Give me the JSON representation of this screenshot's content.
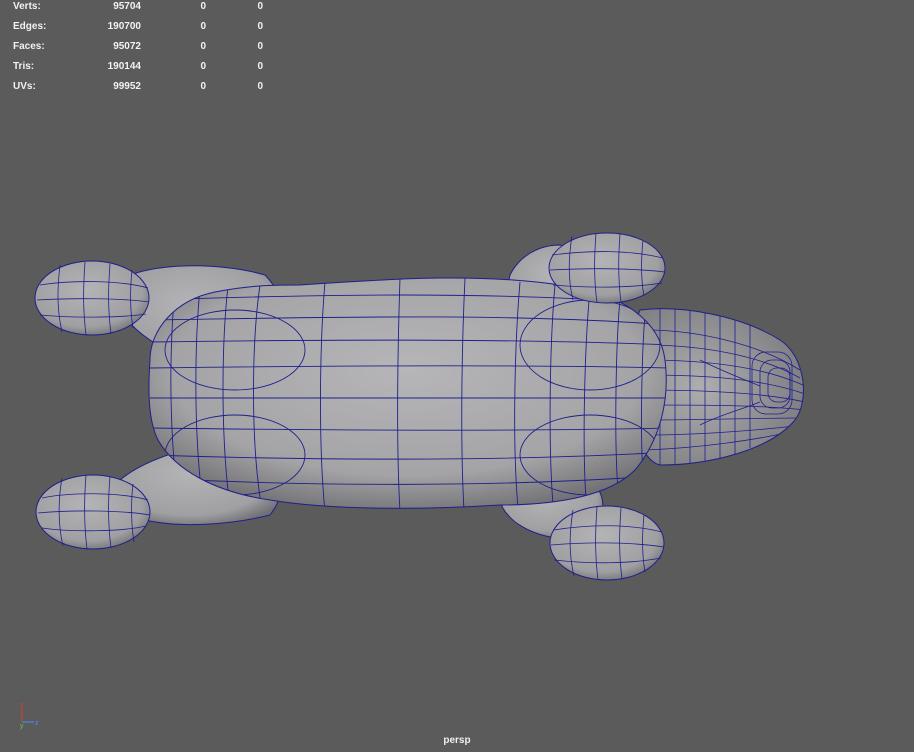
{
  "hud": {
    "rows": [
      {
        "label": "Verts:",
        "v1": "95704",
        "v2": "0",
        "v3": "0"
      },
      {
        "label": "Edges:",
        "v1": "190700",
        "v2": "0",
        "v3": "0"
      },
      {
        "label": "Faces:",
        "v1": "95072",
        "v2": "0",
        "v3": "0"
      },
      {
        "label": "Tris:",
        "v1": "190144",
        "v2": "0",
        "v3": "0"
      },
      {
        "label": "UVs:",
        "v1": "99952",
        "v2": "0",
        "v3": "0"
      }
    ]
  },
  "camera": {
    "name": "persp"
  },
  "axis": {
    "x_label": "x",
    "y_label": "y",
    "z_label": "z",
    "x_color": "#e23a3a",
    "y_color": "#4fd24f",
    "z_color": "#4a8cff"
  },
  "colors": {
    "viewport_bg": "#5b5b5b",
    "mesh_fill": "#a9a9ab",
    "wire": "#1f1f8c"
  }
}
